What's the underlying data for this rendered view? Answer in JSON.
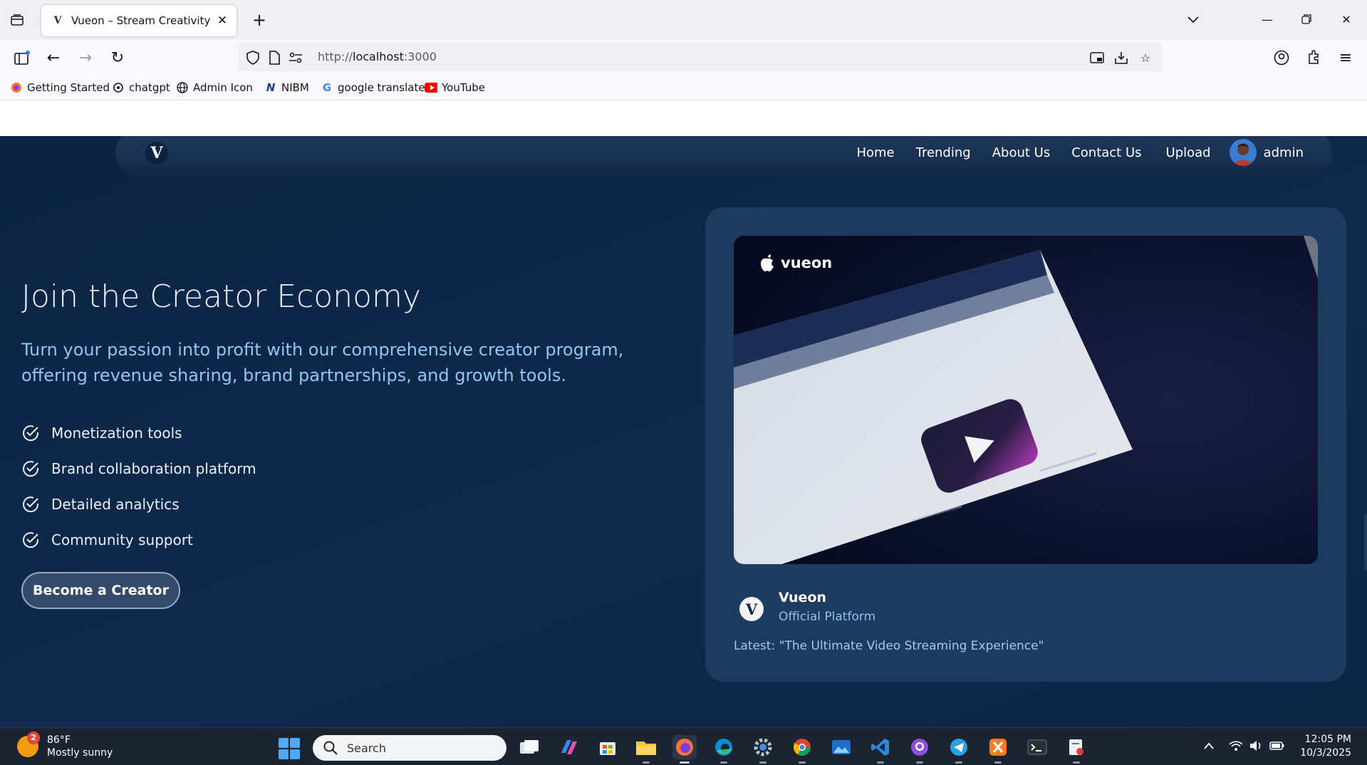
{
  "browser": {
    "tab_title": "Vueon – Stream Creativity",
    "tab_favicon": "V",
    "url_scheme": "http://",
    "url_host": "localhost",
    "url_port": ":3000",
    "bookmarks": [
      "Getting Started",
      "chatgpt",
      "Admin Icon",
      "NIBM",
      "google translate",
      "YouTube"
    ]
  },
  "site": {
    "logo_letter": "V",
    "nav": [
      "Home",
      "Trending",
      "About Us",
      "Contact Us",
      "Upload"
    ],
    "user_name": "admin"
  },
  "hero": {
    "title": "Join the Creator Economy",
    "subtitle": "Turn your passion into profit with our comprehensive creator program, offering revenue sharing, brand partnerships, and growth tools.",
    "features": [
      "Monetization tools",
      "Brand collaboration platform",
      "Detailed analytics",
      "Community support"
    ],
    "cta_label": "Become a Creator"
  },
  "card": {
    "video_brand": "vueon",
    "channel_name": "Vueon",
    "channel_role": "Official Platform",
    "latest": "Latest: \"The Ultimate Video Streaming Experience\""
  },
  "taskbar": {
    "weather_temp": "86°F",
    "weather_desc": "Mostly sunny",
    "weather_badge": "2",
    "search_placeholder": "Search",
    "time": "12:05 PM",
    "date": "10/3/2025"
  },
  "colors": {
    "page_bg": "#0e2748",
    "card_bg": "#1d3a5f",
    "subtitle": "#93c5f3",
    "accent": "#3b7bd3"
  }
}
